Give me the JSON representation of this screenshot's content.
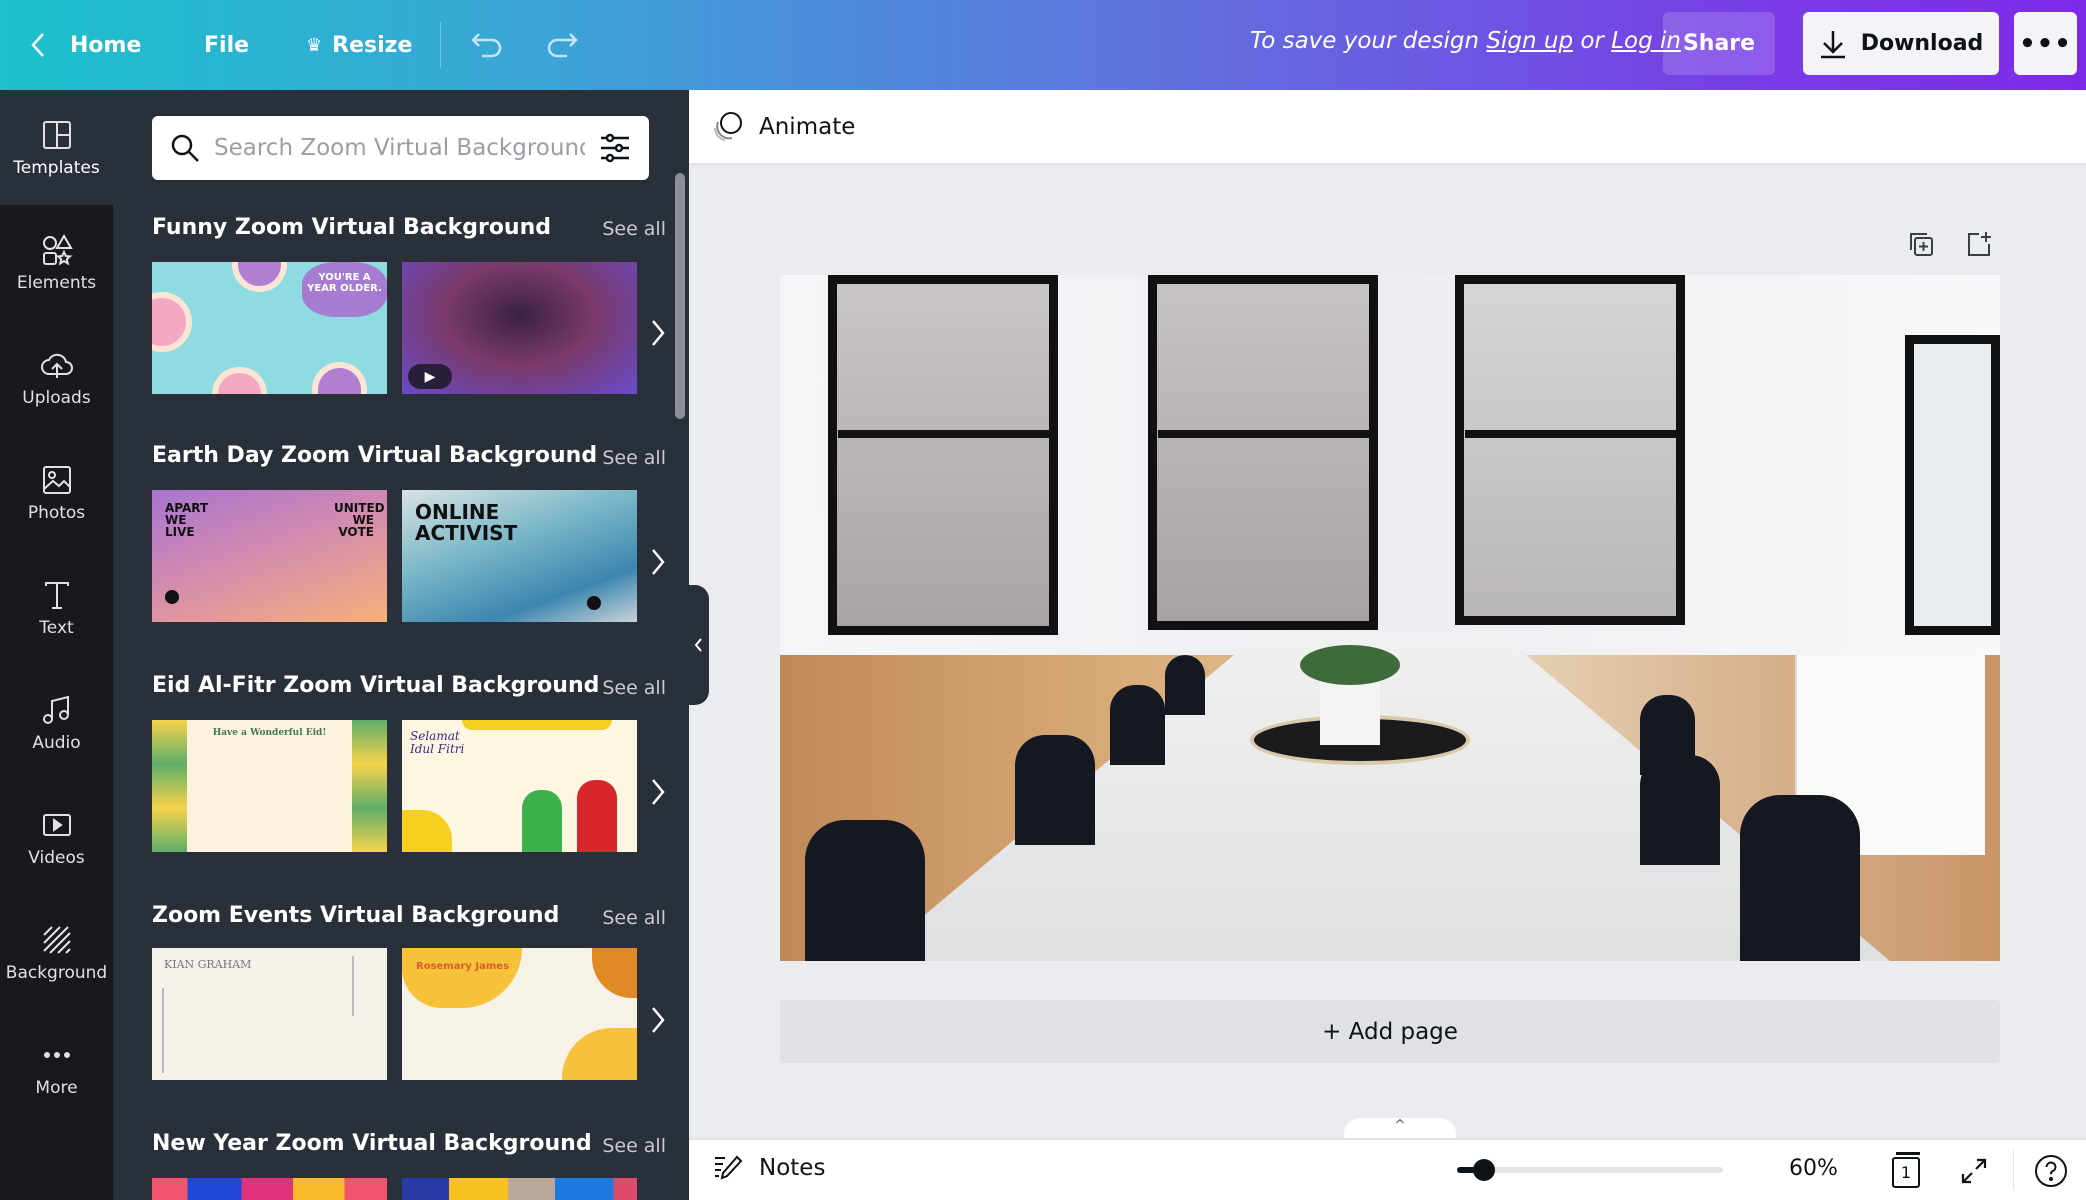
{
  "header": {
    "home": "Home",
    "file": "File",
    "resize": "Resize",
    "save_prefix": "To save your design",
    "sign_up": "Sign up",
    "or": "or",
    "log_in": "Log in",
    "share": "Share",
    "download": "Download",
    "more": "•••"
  },
  "rail": [
    {
      "label": "Templates",
      "icon": "templates-icon"
    },
    {
      "label": "Elements",
      "icon": "elements-icon"
    },
    {
      "label": "Uploads",
      "icon": "uploads-icon"
    },
    {
      "label": "Photos",
      "icon": "photos-icon"
    },
    {
      "label": "Text",
      "icon": "text-icon"
    },
    {
      "label": "Audio",
      "icon": "audio-icon"
    },
    {
      "label": "Videos",
      "icon": "videos-icon"
    },
    {
      "label": "Background",
      "icon": "background-icon"
    },
    {
      "label": "More",
      "icon": "more-icon"
    }
  ],
  "search": {
    "placeholder": "Search Zoom Virtual Background templates"
  },
  "sections": [
    {
      "title": "Funny Zoom Virtual Background",
      "see_all": "See all",
      "thumbs": [
        {
          "text": "YOU'RE A YEAR OLDER."
        },
        {
          "text": ""
        }
      ]
    },
    {
      "title": "Earth Day Zoom Virtual Background",
      "see_all": "See all",
      "thumbs": [
        {
          "text": "APART WE LIVE",
          "text2": "UNITED WE VOTE"
        },
        {
          "text": "ONLINE ACTIVIST"
        }
      ]
    },
    {
      "title": "Eid Al-Fitr Zoom Virtual Background",
      "see_all": "See all",
      "thumbs": [
        {
          "text": "Have a Wonderful Eid!"
        },
        {
          "text": "Selamat Idul Fitri"
        }
      ]
    },
    {
      "title": "Zoom Events Virtual Background",
      "see_all": "See all",
      "thumbs": [
        {
          "text": "KIAN GRAHAM"
        },
        {
          "text": "Rosemary James"
        }
      ]
    },
    {
      "title": "New Year Zoom Virtual Background",
      "see_all": "See all",
      "thumbs": [
        {
          "text": ""
        },
        {
          "text": ""
        }
      ]
    }
  ],
  "toolbar": {
    "animate": "Animate"
  },
  "canvas": {
    "add_page": "+ Add page"
  },
  "bottom": {
    "notes": "Notes",
    "zoom": "60%",
    "zoom_percent": 60,
    "page_number": "1"
  },
  "colors": {
    "header_start": "#1bc1cc",
    "header_end": "#7d2ae8",
    "rail_bg": "#18191f",
    "panel_bg": "#293039",
    "canvas_bg": "#ebecf0"
  }
}
